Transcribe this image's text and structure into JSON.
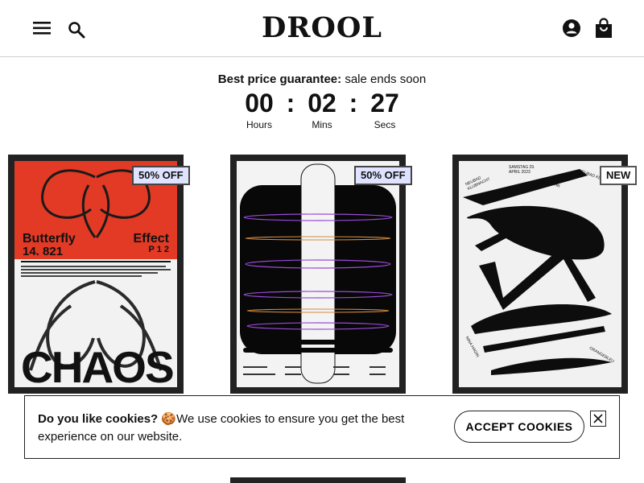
{
  "header": {
    "logo": "DROOL",
    "icons": {
      "menu": "menu-icon",
      "search": "search-icon",
      "account": "account-icon",
      "cart": "shopping-bag-icon"
    }
  },
  "promo": {
    "strong": "Best price guarantee:",
    "text": " sale ends soon"
  },
  "countdown": {
    "hours": "00",
    "hours_label": "Hours",
    "mins": "02",
    "mins_label": "Mins",
    "secs": "27",
    "secs_label": "Secs",
    "separator": ":"
  },
  "products": [
    {
      "badge": "50% OFF",
      "poster": {
        "title_left": "Butterfly",
        "number": "14. 821",
        "title_right": "Effect",
        "marks": "P 1 2",
        "big": "CHAOS"
      }
    },
    {
      "badge": "50% OFF"
    },
    {
      "badge": "NEW",
      "poster": {
        "top": "SAMSTAG 29. APRIL 2023",
        "left": "NEUBAD KLUBNACHT",
        "right": "NEUBAD KLUB",
        "time": "23 UHR",
        "name1": "NINA HAGIN",
        "name2": "TWOETS",
        "name3": "ORANGEBLEU"
      }
    }
  ],
  "cookie": {
    "strong": "Do you like cookies?",
    "emoji": "🍪",
    "text": "We use cookies to ensure you get the best experience on our website.",
    "accept": "ACCEPT COOKIES",
    "close_icon": "close-icon"
  },
  "colors": {
    "badge_sale": "#dfe3ff",
    "poster_red": "#e23a25",
    "frame": "#222222"
  }
}
